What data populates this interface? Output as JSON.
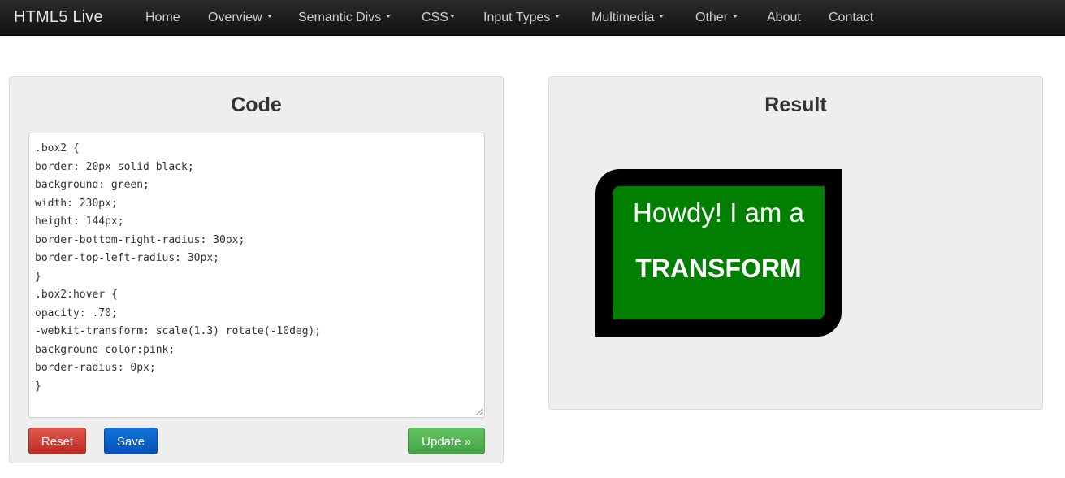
{
  "navbar": {
    "brand": "HTML5 Live",
    "items": [
      {
        "label": "Home"
      },
      {
        "label": "Overview"
      },
      {
        "label": "Semantic Divs"
      },
      {
        "label": "CSS"
      },
      {
        "label": "Input Types"
      },
      {
        "label": "Multimedia"
      },
      {
        "label": "Other"
      },
      {
        "label": "About"
      },
      {
        "label": "Contact"
      }
    ]
  },
  "code_panel": {
    "title": "Code",
    "lines": [
      ".box2 {",
      "border: 20px solid black;",
      "background: green;",
      "width: 230px;",
      "height: 144px;",
      "border-bottom-right-radius: 30px;",
      "border-top-left-radius: 30px;",
      "}",
      ".box2:hover {",
      "opacity: .70;",
      "-webkit-transform: scale(1.3) rotate(-10deg);",
      "background-color:pink;",
      "border-radius: 0px;",
      "}"
    ],
    "buttons": {
      "reset": "Reset",
      "save": "Save",
      "update": "Update",
      "update_suffix": "»"
    }
  },
  "result_panel": {
    "title": "Result",
    "box": {
      "line1": "Howdy! I am a",
      "line2": "TRANSFORM"
    }
  },
  "colors": {
    "navbar": "#1b1b1b",
    "reset": "#d9443a",
    "save": "#0a65cc",
    "update": "#53b153",
    "demo_background": "#007f00",
    "demo_border": "#000000"
  }
}
